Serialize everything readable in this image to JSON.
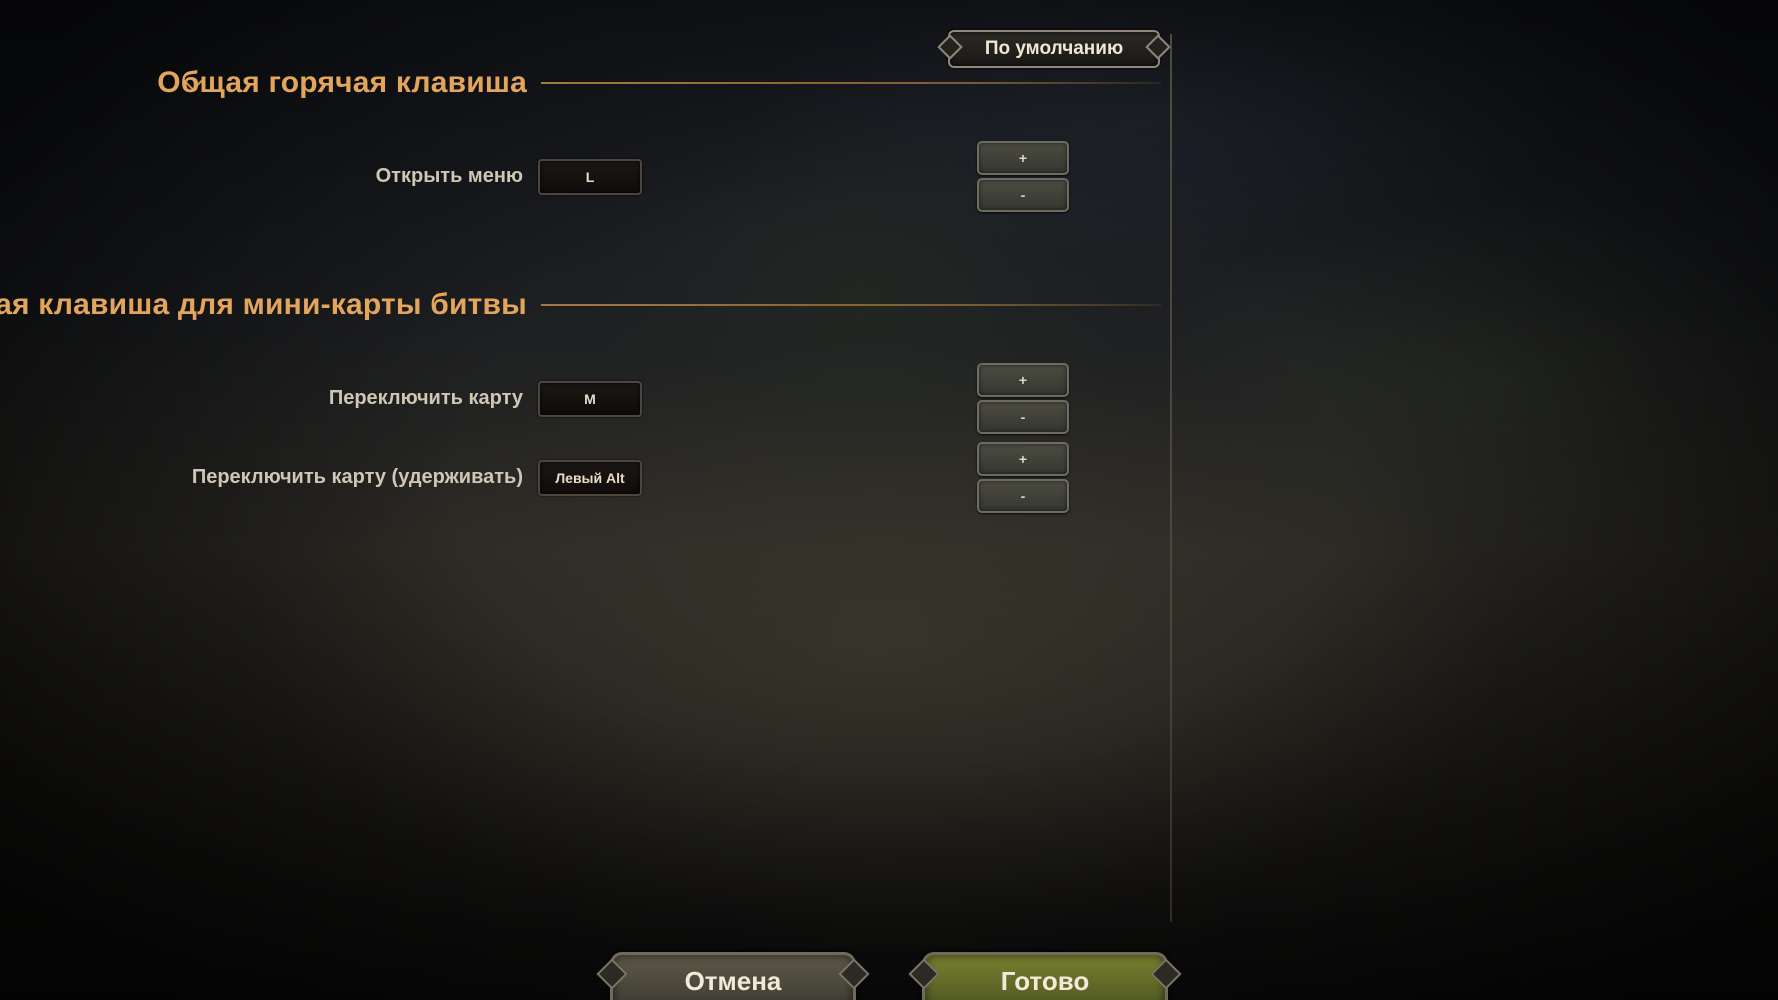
{
  "toolbar": {
    "defaults_label": "По умолчанию"
  },
  "sections": [
    {
      "title": "Общая горячая клавиша",
      "rows": [
        {
          "label": "Открыть меню",
          "key": "L",
          "plus": "+",
          "minus": "-"
        }
      ]
    },
    {
      "title": "Горячая клавиша для мини-карты битвы",
      "rows": [
        {
          "label": "Переключить карту",
          "key": "M",
          "plus": "+",
          "minus": "-"
        },
        {
          "label": "Переключить карту (удерживать)",
          "key": "Левый Alt",
          "plus": "+",
          "minus": "-"
        }
      ]
    }
  ],
  "footer": {
    "cancel_label": "Отмена",
    "done_label": "Готово"
  },
  "colors": {
    "accent_gold": "#e3a55c",
    "done_green": "#77802f"
  },
  "icons": {
    "collapse": "chevron-down-icon"
  }
}
